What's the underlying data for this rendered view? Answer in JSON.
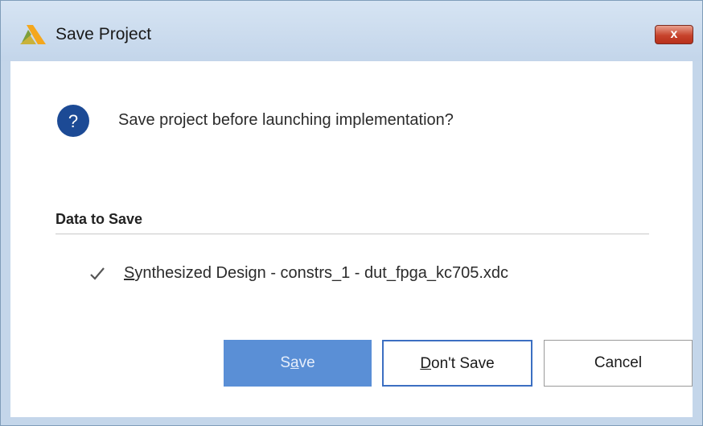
{
  "window": {
    "title": "Save Project",
    "close_label": "x"
  },
  "dialog": {
    "icon": "question-icon",
    "question_mark": "?",
    "message": "Save project before launching implementation?",
    "section_title": "Data to Save",
    "items": [
      {
        "checked": true,
        "label_first_char": "S",
        "label_rest": "ynthesized Design - constrs_1 - dut_fpga_kc705.xdc"
      }
    ]
  },
  "buttons": {
    "save_pre": "S",
    "save_ul": "a",
    "save_post": "ve",
    "dontsave_ul": "D",
    "dontsave_post": "on't Save",
    "cancel": "Cancel"
  },
  "colors": {
    "accent": "#5a8fd6",
    "focus_border": "#3c6fc2",
    "close": "#c7432c",
    "question_icon": "#1c4a95"
  }
}
